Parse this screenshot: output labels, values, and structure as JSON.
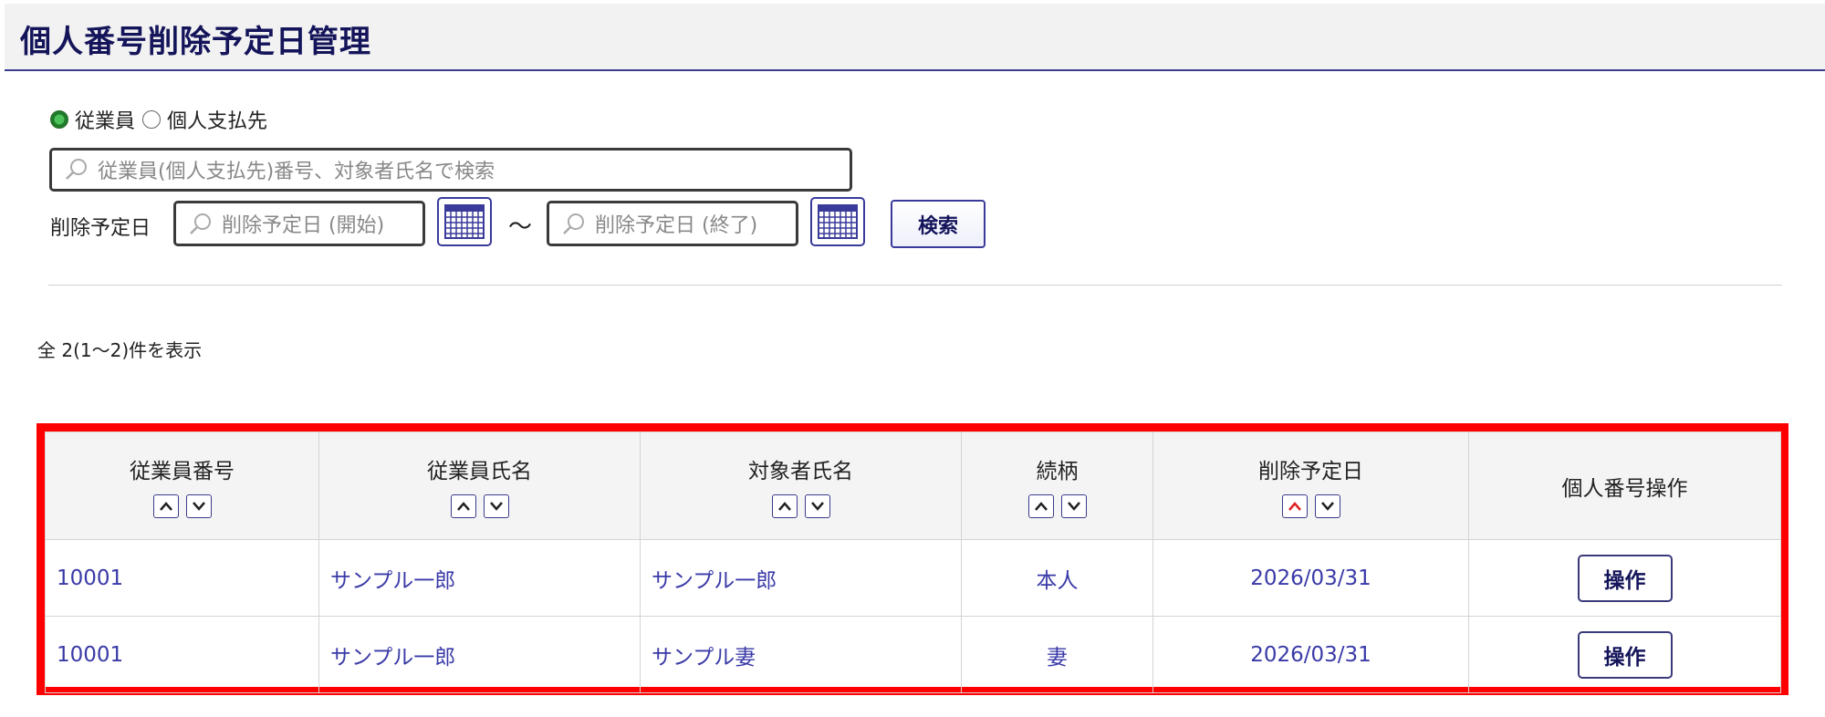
{
  "page": {
    "title": "個人番号削除予定日管理"
  },
  "filter": {
    "radio_options": [
      {
        "label": "従業員",
        "selected": true
      },
      {
        "label": "個人支払先",
        "selected": false
      }
    ],
    "search_placeholder": "従業員(個人支払先)番号、対象者氏名で検索",
    "date_label": "削除予定日",
    "date_start_placeholder": "削除予定日 (開始)",
    "date_end_placeholder": "削除予定日 (終了)",
    "range_separator": "～",
    "search_button": "検索"
  },
  "result": {
    "count_text": "全 2(1～2)件を表示"
  },
  "table": {
    "headers": [
      "従業員番号",
      "従業員氏名",
      "対象者氏名",
      "続柄",
      "削除予定日",
      "個人番号操作"
    ],
    "rows": [
      {
        "emp_no": "10001",
        "emp_name": "サンプル一郎",
        "target_name": "サンプル一郎",
        "relation": "本人",
        "delete_date": "2026/03/31",
        "action": "操作"
      },
      {
        "emp_no": "10001",
        "emp_name": "サンプル一郎",
        "target_name": "サンプル妻",
        "relation": "妻",
        "delete_date": "2026/03/31",
        "action": "操作"
      }
    ],
    "active_sort": "削除予定日 ascending"
  },
  "colors": {
    "highlight": "#ff0000",
    "link": "#3a3aa8",
    "title": "#14145a",
    "active_sort_arrow": "#e02020"
  }
}
